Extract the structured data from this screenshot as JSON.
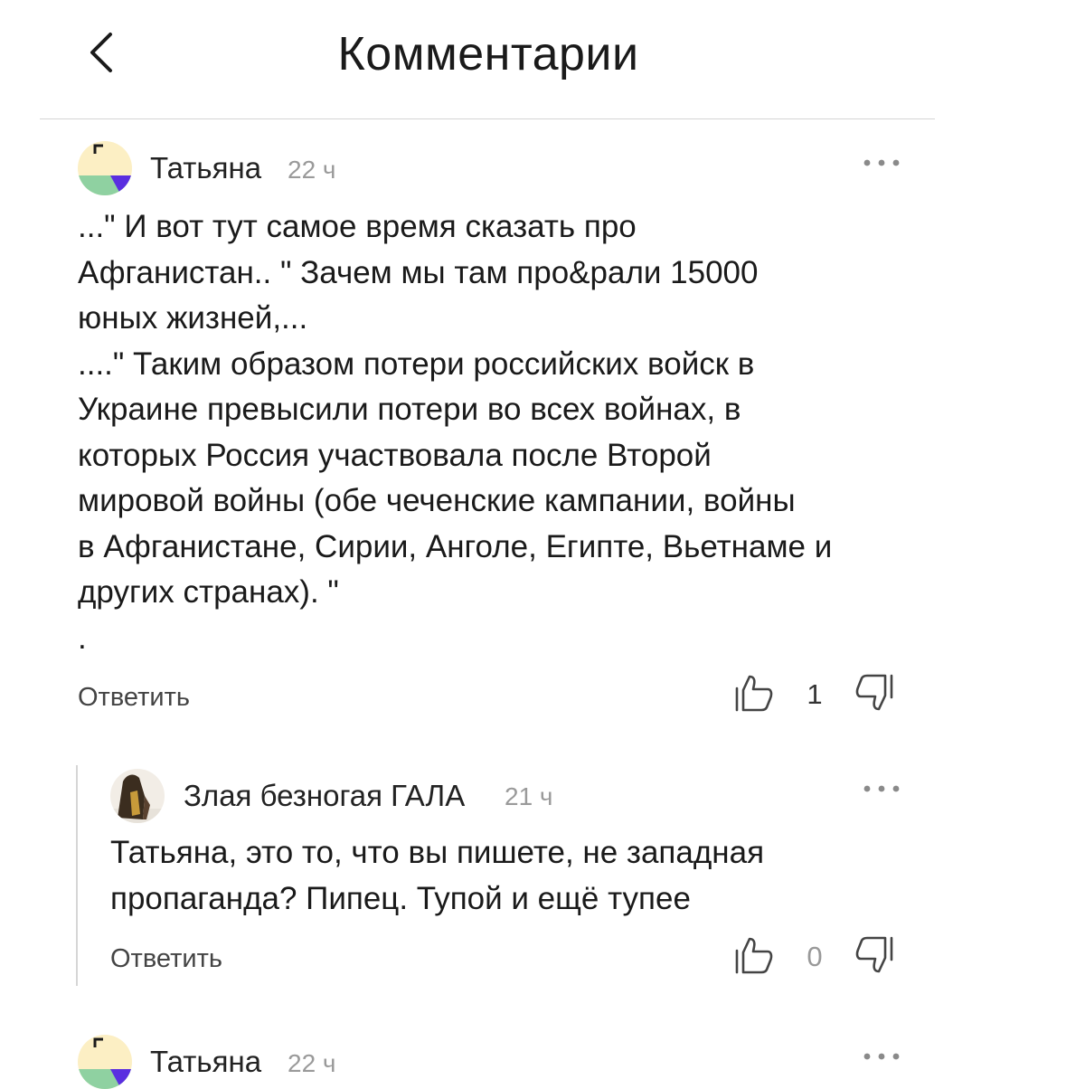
{
  "header": {
    "title": "Комментарии"
  },
  "comments": [
    {
      "author": "Татьяна",
      "time": "22 ч",
      "text": "...\" И вот тут самое время сказать про\nАфганистан.. \" Зачем мы там про&рали 15000\nюных жизней,...\n....\" Таким образом потери российских войск в\nУкраине превысили потери во всех войнах, в\nкоторых Россия участвовала после Второй\nмировой войны (обе чеченские кампании, войны\nв Афганистане, Сирии, Анголе, Египте, Вьетнаме и\nдругих странах). \"\n.",
      "reply_label": "Ответить",
      "likes": "1"
    },
    {
      "author": "Злая безногая ГАЛА",
      "time": "21 ч",
      "text": "Татьяна, это то, что вы пишете, не западная\nпропаганда? Пипец. Тупой и ещё тупее",
      "reply_label": "Ответить",
      "likes": "0"
    },
    {
      "author": "Татьяна",
      "time": "22 ч"
    }
  ],
  "colors": {
    "avatar_yellow": "#fcefc4",
    "avatar_green": "#8fd1a1",
    "avatar_purple": "#5a2ee0",
    "divider": "#d4d4d4",
    "muted_text": "#9a9a9a"
  },
  "icons": {
    "back": "chevron-left-icon",
    "more": "more-dots-icon",
    "like": "thumbs-up-icon",
    "dislike": "thumbs-down-icon"
  }
}
